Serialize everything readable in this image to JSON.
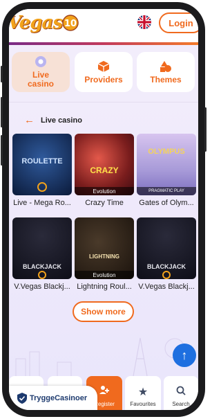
{
  "header": {
    "logo_text": "Vegas",
    "language_flag": "uk-flag-icon",
    "login_label": "Login"
  },
  "categories": [
    {
      "label": "Live\ncasino",
      "icon": "live-casino-icon",
      "active": true
    },
    {
      "label": "Providers",
      "icon": "cube-icon",
      "active": false
    },
    {
      "label": "Themes",
      "icon": "shapes-icon",
      "active": false
    }
  ],
  "section": {
    "back_icon": "arrow-left-icon",
    "title": "Live casino"
  },
  "games": [
    {
      "name": "Live - Mega Ro...",
      "thumb_title": "ROULETTE",
      "provider": ""
    },
    {
      "name": "Crazy Time",
      "thumb_title": "CRAZY",
      "provider": "Evolution"
    },
    {
      "name": "Gates of Olym...",
      "thumb_title": "OLYMPUS",
      "provider": "PRAGMATIC PLAY"
    },
    {
      "name": "V.Vegas Blackj...",
      "thumb_title": "BLACKJACK",
      "provider": ""
    },
    {
      "name": "Lightning Roul...",
      "thumb_title": "LIGHTNING",
      "provider": "Evolution"
    },
    {
      "name": "V.Vegas Blackj...",
      "thumb_title": "BLACKJACK",
      "provider": ""
    }
  ],
  "show_more_label": "Show more",
  "scroll_top_icon": "arrow-up-icon",
  "bottom_nav": {
    "register_label": "Register",
    "favourites_label": "Favourites",
    "search_label": "Search"
  },
  "badge": {
    "brand": "TryggeCasinoer"
  },
  "colors": {
    "accent": "#f06a1e",
    "scroll_button": "#1e6fe0"
  }
}
